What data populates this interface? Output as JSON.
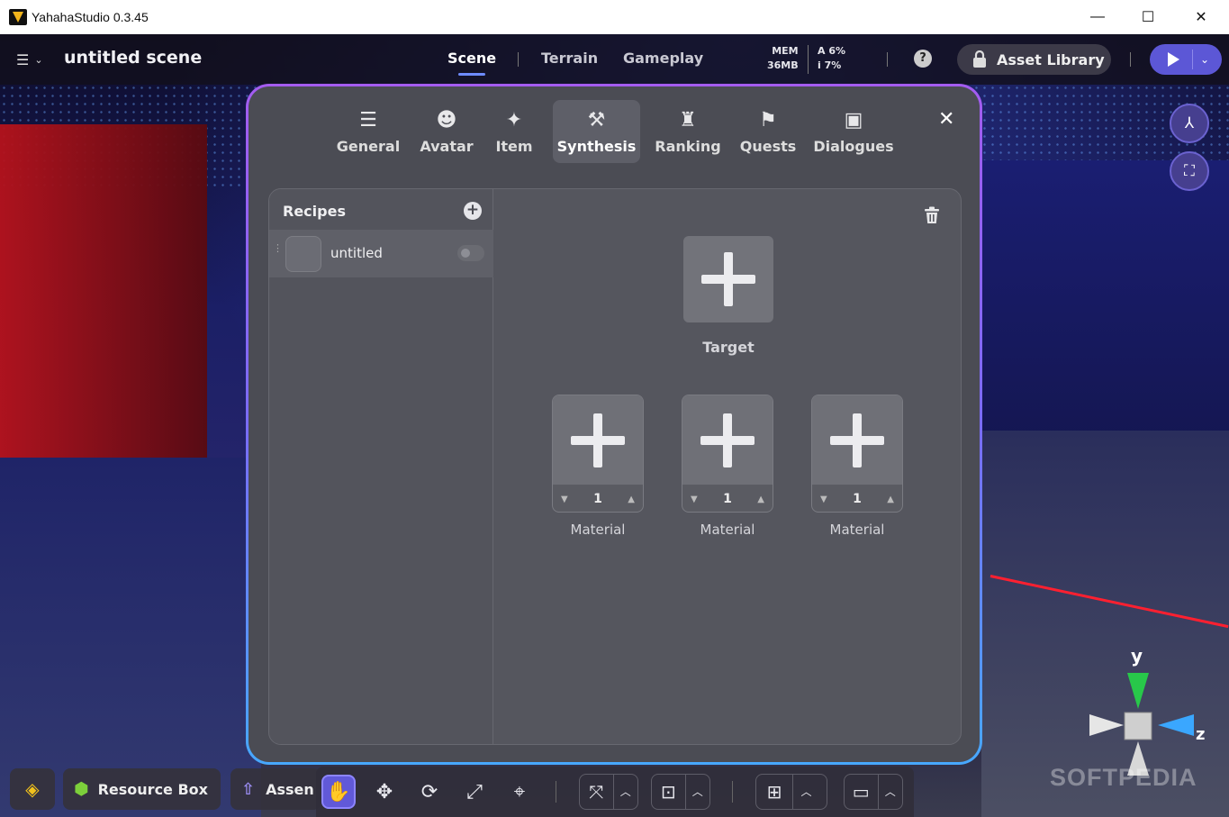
{
  "window": {
    "title": "YahahaStudio 0.3.45",
    "minimize": "—",
    "maximize": "☐",
    "close": "✕"
  },
  "topbar": {
    "scene_name": "untitled scene",
    "tabs": [
      {
        "label": "Scene",
        "active": true
      },
      {
        "label": "Terrain"
      },
      {
        "label": "Gameplay"
      }
    ],
    "stats": {
      "mem_label": "MEM",
      "mem_value": "36MB",
      "a_label": "A",
      "a_value": "6%",
      "i_label": "i",
      "i_value": "7%"
    },
    "asset_library": "Asset Library",
    "help": "?"
  },
  "modal": {
    "tabs": [
      {
        "label": "General",
        "icon": "sliders-icon"
      },
      {
        "label": "Avatar",
        "icon": "avatar-icon"
      },
      {
        "label": "Item",
        "icon": "item-icon"
      },
      {
        "label": "Synthesis",
        "icon": "hammer-icon",
        "active": true
      },
      {
        "label": "Ranking",
        "icon": "trophy-icon"
      },
      {
        "label": "Quests",
        "icon": "flag-icon"
      },
      {
        "label": "Dialogues",
        "icon": "chat-icon"
      }
    ],
    "recipes": {
      "header": "Recipes",
      "items": [
        {
          "name": "untitled",
          "enabled": false
        }
      ]
    },
    "target_label": "Target",
    "materials": [
      {
        "label": "Material",
        "qty": "1"
      },
      {
        "label": "Material",
        "qty": "1"
      },
      {
        "label": "Material",
        "qty": "1"
      }
    ]
  },
  "bottom": {
    "resource_box": "Resource Box",
    "assets": "Assen"
  },
  "watermark": "SOFTPEDIA",
  "gizmo": {
    "y": "y",
    "z": "z"
  },
  "colors": {
    "accent": "#6159d8",
    "modal_border_top": "#a45cf0",
    "modal_border_bottom": "#47a8ff"
  }
}
